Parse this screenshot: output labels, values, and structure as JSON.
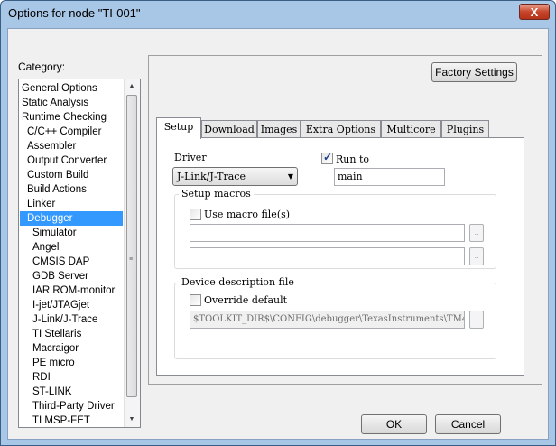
{
  "window": {
    "title": "Options for node \"TI-001\"",
    "close_glyph": "X"
  },
  "category": {
    "label": "Category:",
    "selected_index": 9,
    "items": [
      {
        "label": "General Options",
        "indent": 0
      },
      {
        "label": "Static Analysis",
        "indent": 0
      },
      {
        "label": "Runtime Checking",
        "indent": 0
      },
      {
        "label": "C/C++ Compiler",
        "indent": 1
      },
      {
        "label": "Assembler",
        "indent": 1
      },
      {
        "label": "Output Converter",
        "indent": 1
      },
      {
        "label": "Custom Build",
        "indent": 1
      },
      {
        "label": "Build Actions",
        "indent": 1
      },
      {
        "label": "Linker",
        "indent": 1
      },
      {
        "label": "Debugger",
        "indent": 1
      },
      {
        "label": "Simulator",
        "indent": 2
      },
      {
        "label": "Angel",
        "indent": 2
      },
      {
        "label": "CMSIS DAP",
        "indent": 2
      },
      {
        "label": "GDB Server",
        "indent": 2
      },
      {
        "label": "IAR ROM-monitor",
        "indent": 2
      },
      {
        "label": "I-jet/JTAGjet",
        "indent": 2
      },
      {
        "label": "J-Link/J-Trace",
        "indent": 2
      },
      {
        "label": "TI Stellaris",
        "indent": 2
      },
      {
        "label": "Macraigor",
        "indent": 2
      },
      {
        "label": "PE micro",
        "indent": 2
      },
      {
        "label": "RDI",
        "indent": 2
      },
      {
        "label": "ST-LINK",
        "indent": 2
      },
      {
        "label": "Third-Party Driver",
        "indent": 2
      },
      {
        "label": "TI MSP-FET",
        "indent": 2
      }
    ],
    "scroll_up_glyph": "▲",
    "scroll_down_glyph": "▼",
    "scroll_grip_glyph": "≡"
  },
  "factory_settings_label": "Factory Settings",
  "tabs": [
    {
      "label": "Setup",
      "active": true
    },
    {
      "label": "Download",
      "active": false
    },
    {
      "label": "Images",
      "active": false
    },
    {
      "label": "Extra Options",
      "active": false
    },
    {
      "label": "Multicore",
      "active": false
    },
    {
      "label": "Plugins",
      "active": false
    }
  ],
  "setup": {
    "driver_label": "Driver",
    "driver_value": "J-Link/J-Trace",
    "run_to_label": "Run to",
    "run_to_checked": true,
    "run_to_value": "main",
    "setup_macros_label": "Setup macros",
    "use_macro_label": "Use macro file(s)",
    "use_macro_checked": false,
    "macro_file_1": "",
    "macro_file_2": "",
    "device_desc_label": "Device description file",
    "override_label": "Override default",
    "override_checked": false,
    "device_desc_path": "$TOOLKIT_DIR$\\CONFIG\\debugger\\TexasInstruments\\TM4",
    "browse_glyph": "..",
    "check_glyph": "✓",
    "dropdown_glyph": "▼"
  },
  "buttons": {
    "ok": "OK",
    "cancel": "Cancel"
  }
}
